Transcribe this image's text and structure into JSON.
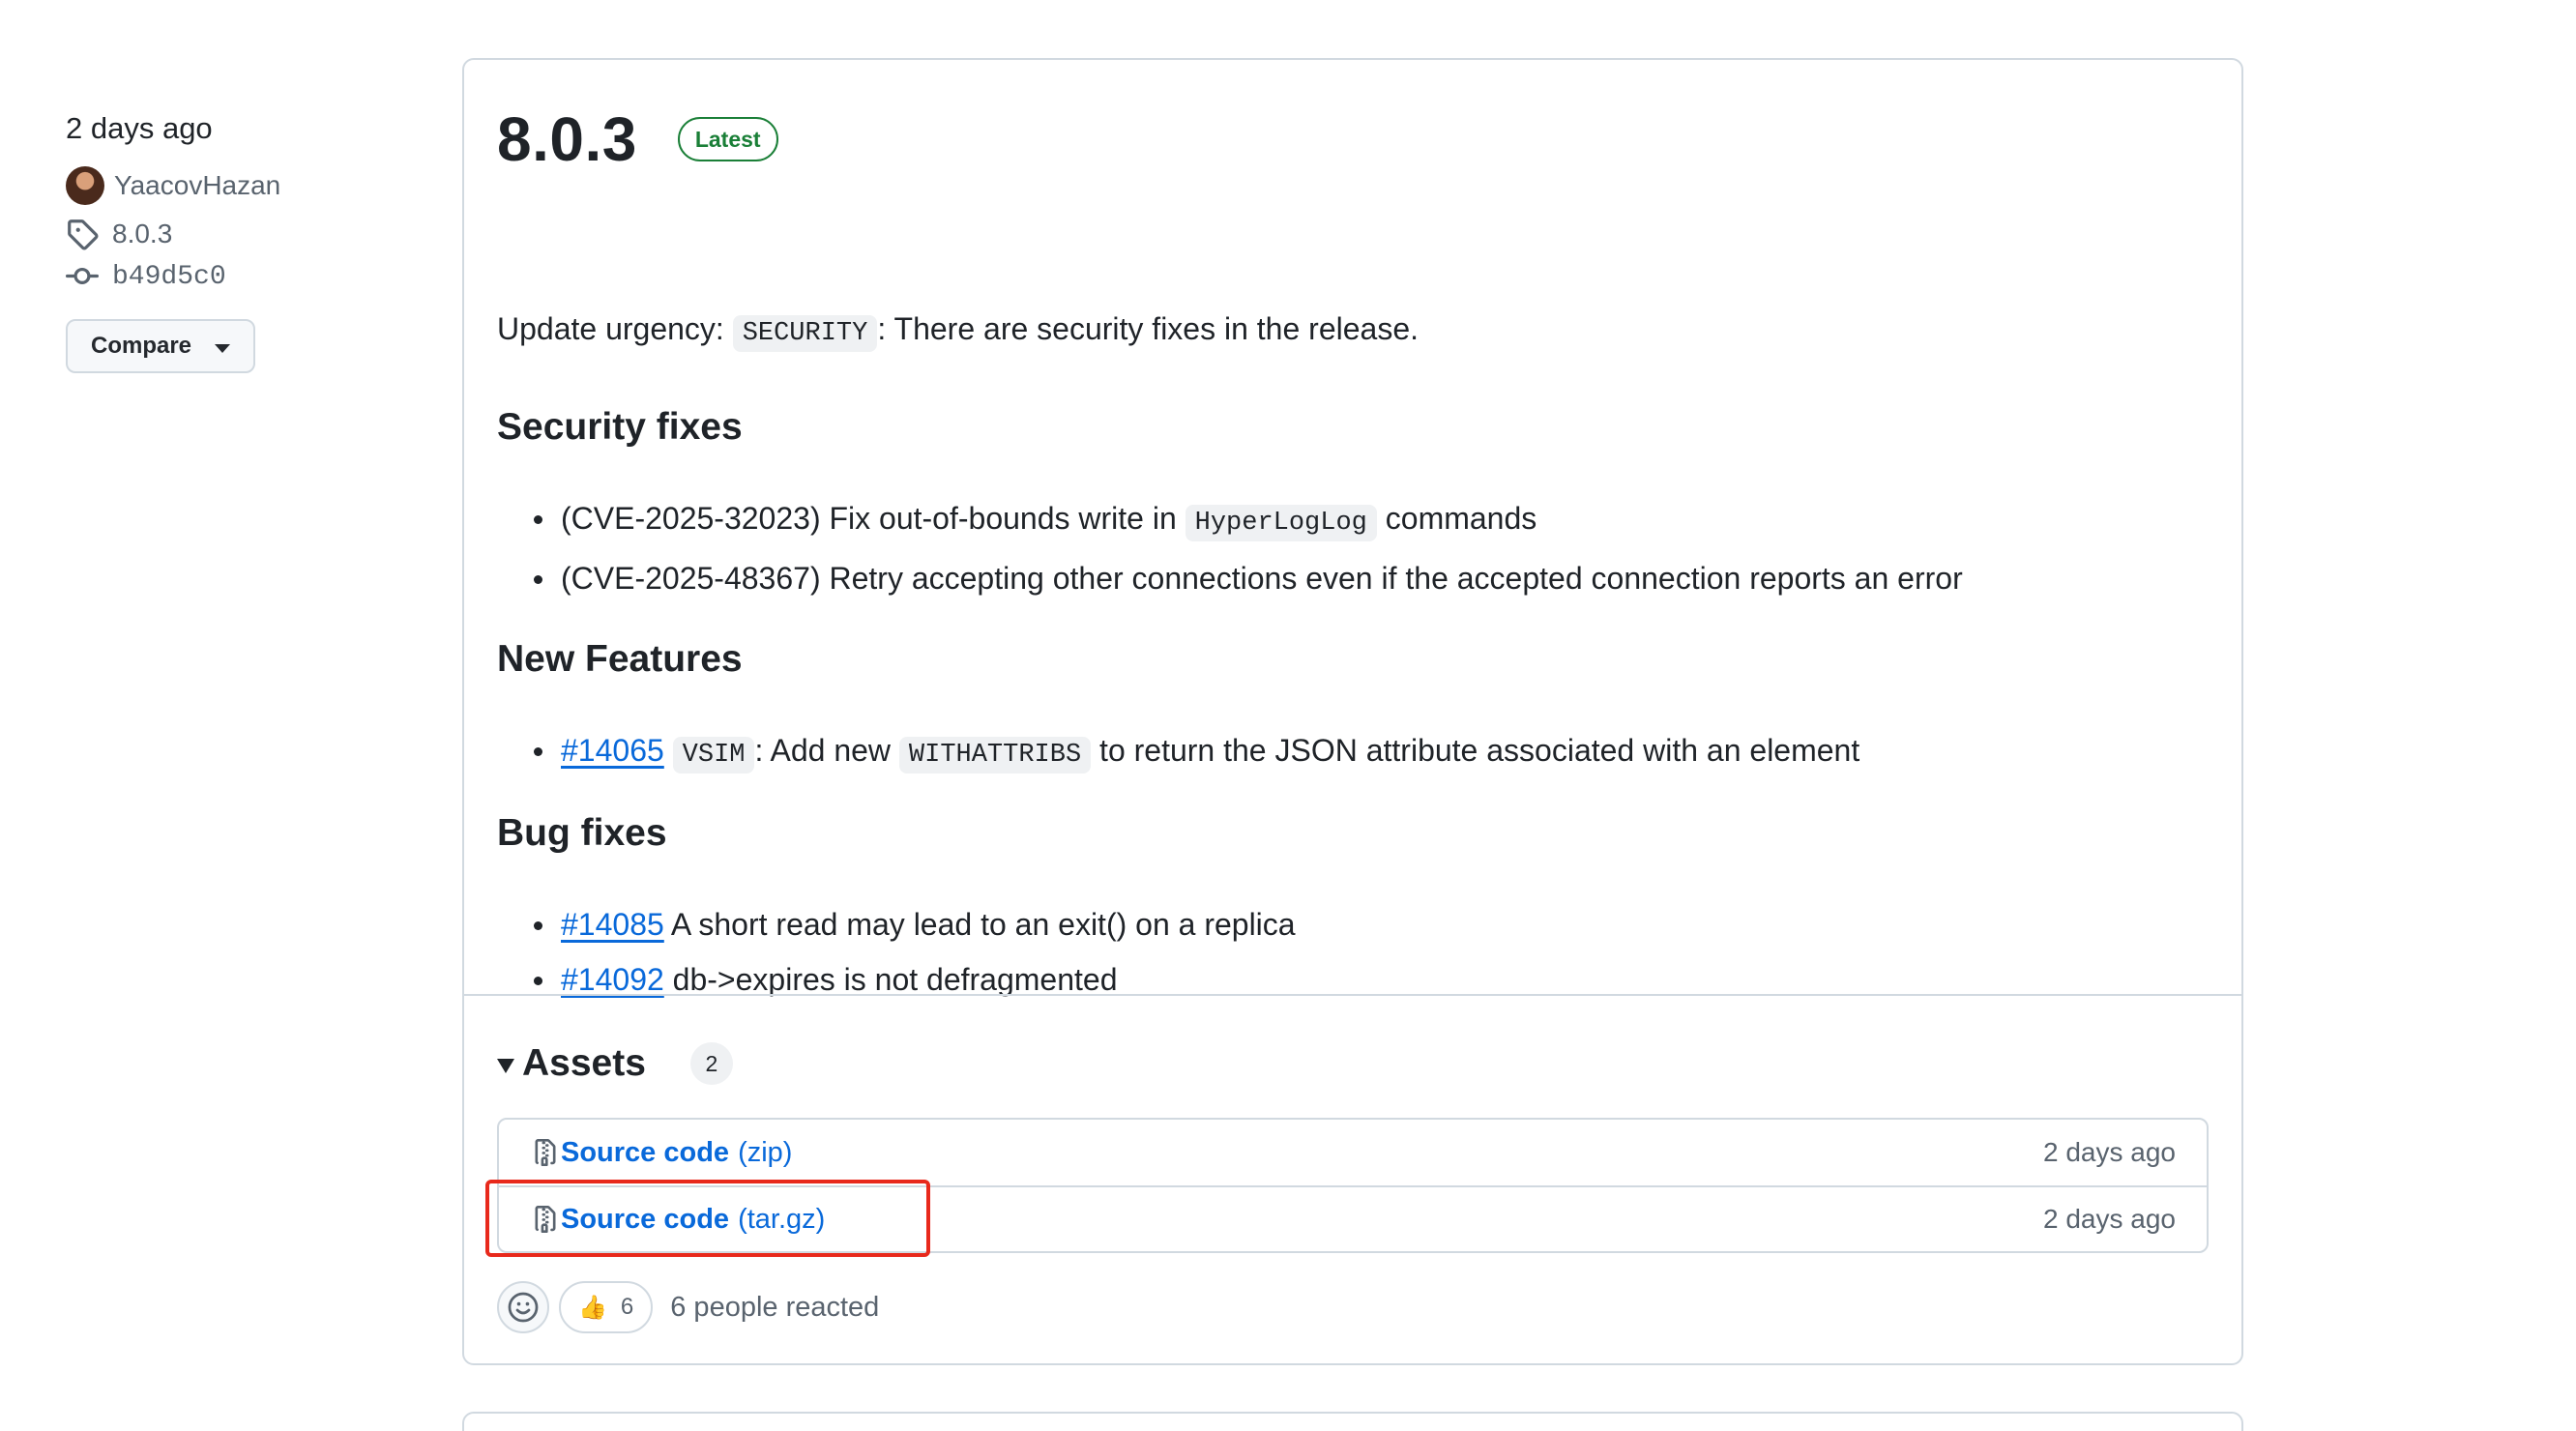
{
  "sidebar": {
    "date": "2 days ago",
    "author": "YaacovHazan",
    "tag": "8.0.3",
    "commit": "b49d5c0",
    "compare_label": "Compare"
  },
  "release": {
    "title": "8.0.3",
    "badge": "Latest",
    "urgency": {
      "prefix": "Update urgency:",
      "code": "SECURITY",
      "suffix": ": There are security fixes in the release."
    },
    "sections": {
      "security": {
        "heading": "Security fixes",
        "items": [
          {
            "pre": "(CVE-2025-32023) Fix out-of-bounds write in",
            "code": "HyperLogLog",
            "post": "commands"
          },
          {
            "text": "(CVE-2025-48367) Retry accepting other connections even if the accepted connection reports an error"
          }
        ]
      },
      "features": {
        "heading": "New Features",
        "items": [
          {
            "link": "#14065",
            "code1": "VSIM",
            "mid": ": Add new",
            "code2": "WITHATTRIBS",
            "post": "to return the JSON attribute associated with an element"
          }
        ]
      },
      "bugs": {
        "heading": "Bug fixes",
        "items": [
          {
            "link": "#14085",
            "text": "A short read may lead to an exit() on a replica"
          },
          {
            "link": "#14092",
            "text": "db->expires is not defragmented"
          }
        ]
      }
    }
  },
  "assets": {
    "title": "Assets",
    "count": "2",
    "rows": [
      {
        "name": "Source code",
        "kind": "(zip)",
        "date": "2 days ago"
      },
      {
        "name": "Source code",
        "kind": "(tar.gz)",
        "date": "2 days ago"
      }
    ]
  },
  "reactions": {
    "emoji": "👍",
    "count": "6",
    "summary": "6 people reacted"
  },
  "colors": {
    "link": "#0969da",
    "latest_badge": "#1a7f37",
    "highlight": "#e8291c",
    "border": "#d1d9e0"
  },
  "icons": [
    "tag-icon",
    "commit-icon",
    "file-zip-icon",
    "smiley-icon",
    "caret-down-icon"
  ]
}
